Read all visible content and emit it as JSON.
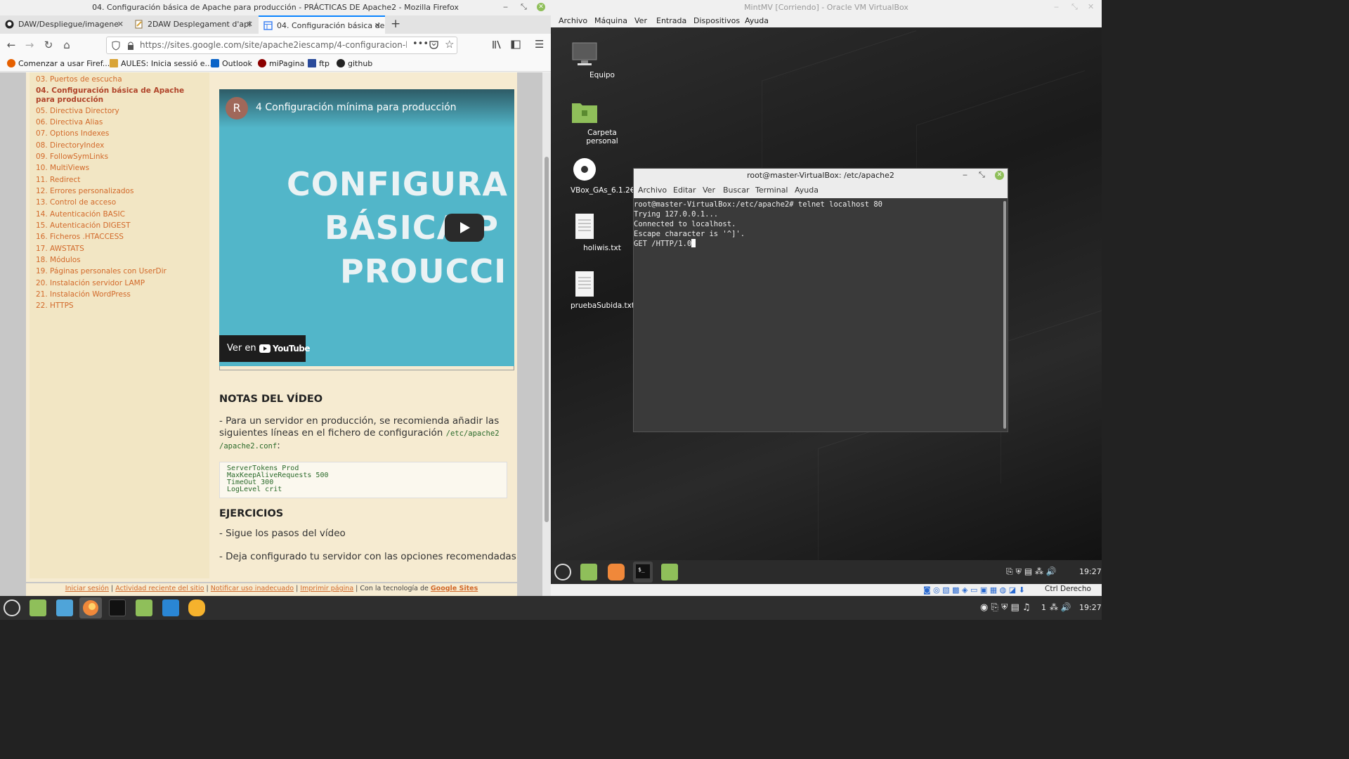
{
  "firefox": {
    "window_title": "04. Configuración básica de Apache para producción - PRÁCTICAS DE Apache2 - Mozilla Firefox",
    "tabs": [
      {
        "label": "DAW/Despliegue/imagene"
      },
      {
        "label": "2DAW Desplegament d'apl"
      },
      {
        "label": "04. Configuración básica de"
      }
    ],
    "url": "https://sites.google.com/site/apache2iescamp/4-configuracion-basica-de",
    "bookmarks": [
      "Comenzar a usar Firef...",
      "AULES: Inicia sessió e...",
      "Outlook",
      "miPagina",
      "ftp",
      "github"
    ],
    "nav_links": [
      "03. Puertos de escucha",
      "04. Configuración básica de Apache para producción",
      "05. Directiva Directory",
      "06. Directiva Alias",
      "07. Options Indexes",
      "08. DirectoryIndex",
      "09. FollowSymLinks",
      "10. MultiViews",
      "11. Redirect",
      "12. Errores personalizados",
      "13. Control de acceso",
      "14. Autenticación BASIC",
      "15. Autenticación DIGEST",
      "16. Ficheros .HTACCESS",
      "17. AWSTATS",
      "18. Módulos",
      "19. Páginas personales con UserDir",
      "20. Instalación servidor LAMP",
      "21. Instalación WordPress",
      "22. HTTPS"
    ],
    "video": {
      "avatar_letter": "R",
      "title": "4 Configuración mínima para producción",
      "big_lines": [
        "CONFIGURA",
        "BÁSICA P",
        "PROUCCI"
      ],
      "watch_on": "Ver en",
      "youtube": "YouTube"
    },
    "notes_heading": "NOTAS DEL VÍDEO",
    "notes_text": "- Para un servidor en producción, se recomienda añadir las siguientes líneas en el fichero de configuración",
    "notes_path": "/etc/apache2 /apache2.conf",
    "notes_colon": ":",
    "code_lines": [
      "ServerTokens Prod",
      "MaxKeepAliveRequests 500",
      "TimeOut 300",
      "LogLevel crit"
    ],
    "exercises_heading": "EJERCICIOS",
    "exercises": [
      "- Sigue los pasos del vídeo",
      "- Deja configurado tu servidor con las opciones recomendadas"
    ],
    "footer": {
      "links": [
        "Iniciar sesión",
        "Actividad reciente del sitio",
        "Notificar uso inadecuado",
        "Imprimir página"
      ],
      "powered": "Con la tecnología de",
      "brand": "Google Sites"
    }
  },
  "virtualbox": {
    "window_title": "MintMV [Corriendo] - Oracle VM VirtualBox",
    "menu": [
      "Archivo",
      "Máquina",
      "Ver",
      "Entrada",
      "Dispositivos",
      "Ayuda"
    ],
    "desktop_icons": [
      "Equipo",
      "Carpeta personal",
      "VBox_GAs_6.1.2€",
      "holiwis.txt",
      "pruebaSubida.txt"
    ],
    "terminal": {
      "title": "root@master-VirtualBox: /etc/apache2",
      "menu": [
        "Archivo",
        "Editar",
        "Ver",
        "Buscar",
        "Terminal",
        "Ayuda"
      ],
      "lines": [
        "root@master-VirtualBox:/etc/apache2# telnet localhost 80",
        "Trying 127.0.0.1...",
        "Connected to localhost.",
        "Escape character is '^]'.",
        "GET /HTTP/1.0"
      ]
    },
    "guest_clock": "19:27",
    "host_key": "Ctrl Derecho"
  },
  "host": {
    "clock": "19:27",
    "workspace": "1"
  },
  "colors": {
    "link": "#d2692a",
    "firefox_accent": "#0a84ff",
    "video_bg": "#52b6c9",
    "mint_green": "#8fbf5a"
  }
}
